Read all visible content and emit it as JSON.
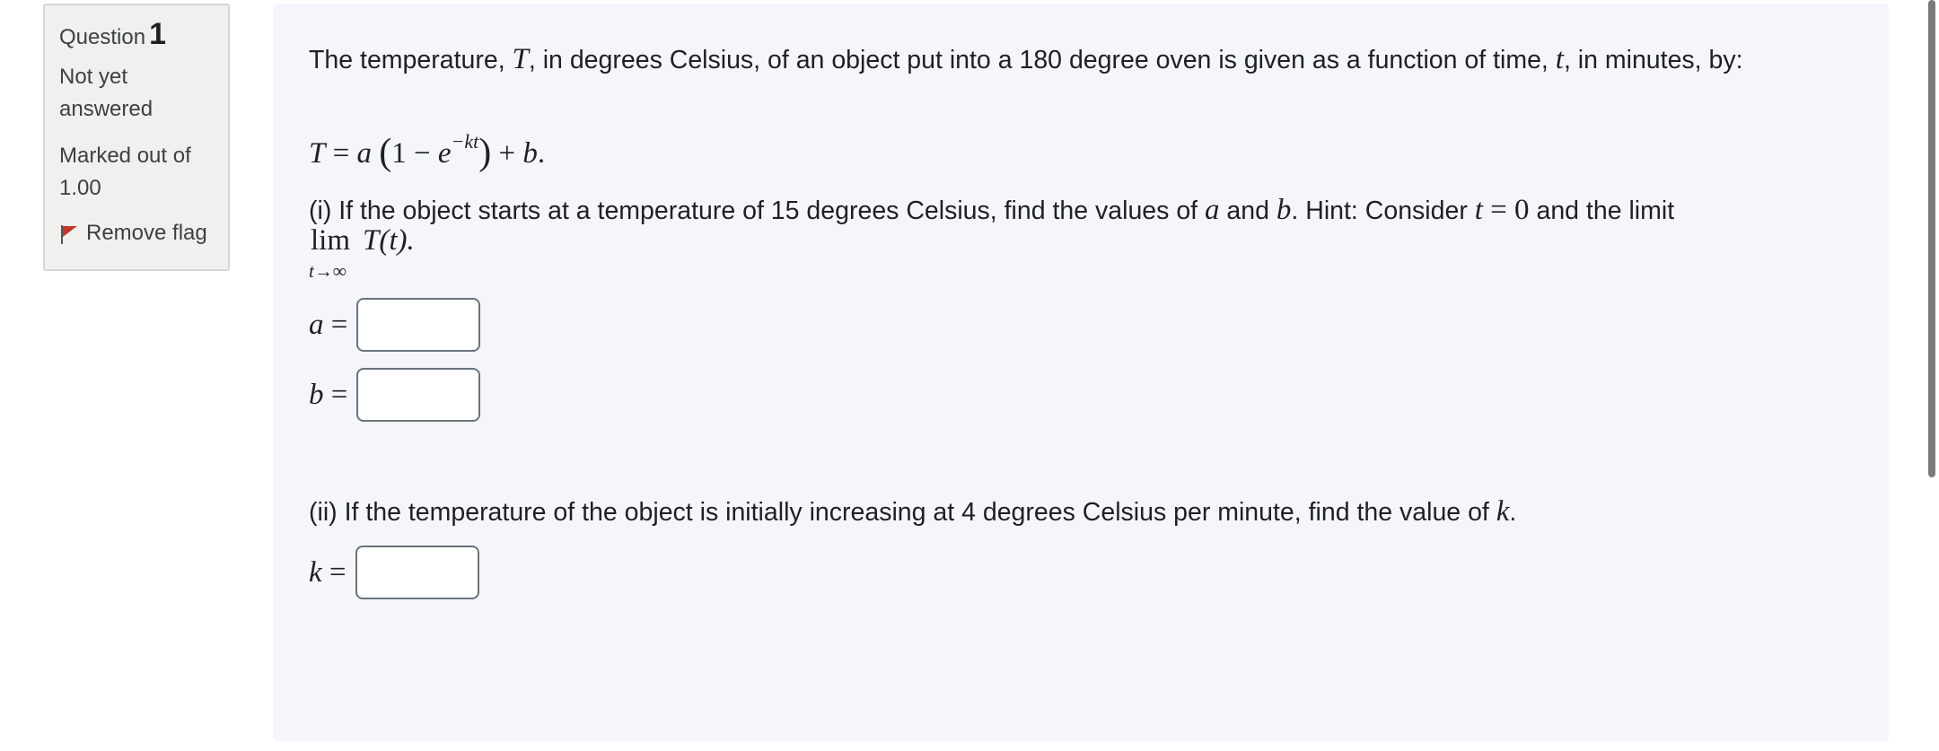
{
  "info": {
    "question_word": "Question",
    "question_number": "1",
    "state": "Not yet answered",
    "grade": "Marked out of 1.00",
    "flag_label": "Remove flag",
    "flag_color": "#c0392b"
  },
  "question": {
    "intro_1": "The temperature, ",
    "var_T": "T",
    "intro_2": ", in degrees Celsius, of an object put into a 180 degree oven is given as a function of time, ",
    "var_t": "t",
    "intro_3": ", in minutes, by:",
    "formula": {
      "lhs": "T",
      "equals": "=",
      "a": "a",
      "one": "1",
      "minus": "−",
      "e": "e",
      "exponent": "−kt",
      "plus": "+",
      "b": "b",
      "period": "."
    },
    "part_i": {
      "text_1": "(i) If the object starts at a temperature of 15 degrees Celsius, find the values of ",
      "var_a": "a",
      "text_2": " and ",
      "var_b": "b",
      "text_3": ". Hint: Consider ",
      "var_t": "t",
      "eq_zero": " = 0",
      "text_4": " and the limit",
      "lim_word": "lim",
      "lim_sub": "t→∞",
      "lim_expr": "T(t)."
    },
    "fields": {
      "a_label": "a",
      "b_label": "b",
      "k_label": "k",
      "equals": "=",
      "a_value": "",
      "b_value": "",
      "k_value": ""
    },
    "part_ii": {
      "text_1": "(ii) If the temperature of the object is initially increasing at 4 degrees Celsius per minute, find the value of ",
      "var_k": "k",
      "text_2": "."
    }
  }
}
